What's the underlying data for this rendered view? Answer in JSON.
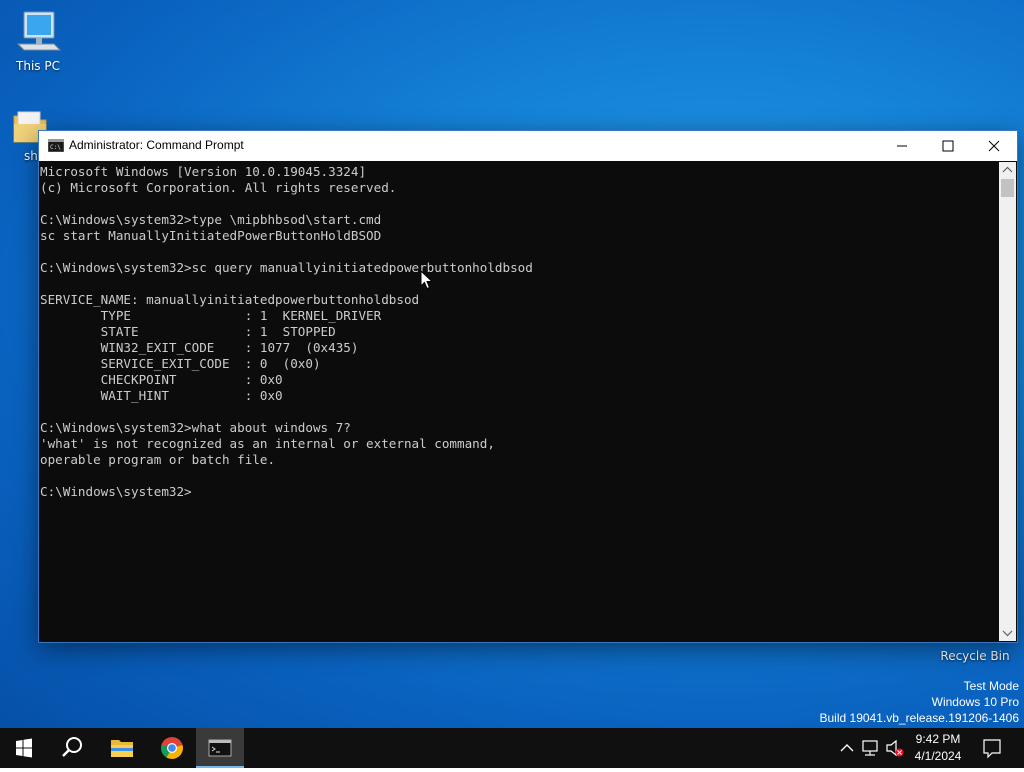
{
  "desktop": {
    "icons": [
      {
        "label": "This PC"
      },
      {
        "label": "sh"
      },
      {
        "label": "Recycle Bin"
      }
    ],
    "watermark": {
      "line1": "Test Mode",
      "line2": "Windows 10 Pro",
      "line3": "Build 19041.vb_release.191206-1406"
    }
  },
  "window": {
    "title": "Administrator: Command Prompt",
    "console_lines": [
      "Microsoft Windows [Version 10.0.19045.3324]",
      "(c) Microsoft Corporation. All rights reserved.",
      "",
      "C:\\Windows\\system32>type \\mipbhbsod\\start.cmd",
      "sc start ManuallyInitiatedPowerButtonHoldBSOD",
      "",
      "C:\\Windows\\system32>sc query manuallyinitiatedpowerbuttonholdbsod",
      "",
      "SERVICE_NAME: manuallyinitiatedpowerbuttonholdbsod",
      "        TYPE               : 1  KERNEL_DRIVER",
      "        STATE              : 1  STOPPED",
      "        WIN32_EXIT_CODE    : 1077  (0x435)",
      "        SERVICE_EXIT_CODE  : 0  (0x0)",
      "        CHECKPOINT         : 0x0",
      "        WAIT_HINT          : 0x0",
      "",
      "C:\\Windows\\system32>what about windows 7?",
      "'what' is not recognized as an internal or external command,",
      "operable program or batch file.",
      "",
      "C:\\Windows\\system32>"
    ]
  },
  "taskbar": {
    "time": "9:42 PM",
    "date": "4/1/2024",
    "pinned": [
      "start-icon",
      "search-icon",
      "file-explorer-icon",
      "chrome-icon",
      "command-prompt-icon"
    ]
  },
  "colors": {
    "console_bg": "#0c0c0c",
    "console_fg": "#cccccc",
    "taskbar_bg": "#101010",
    "accent": "#76b9ed"
  }
}
